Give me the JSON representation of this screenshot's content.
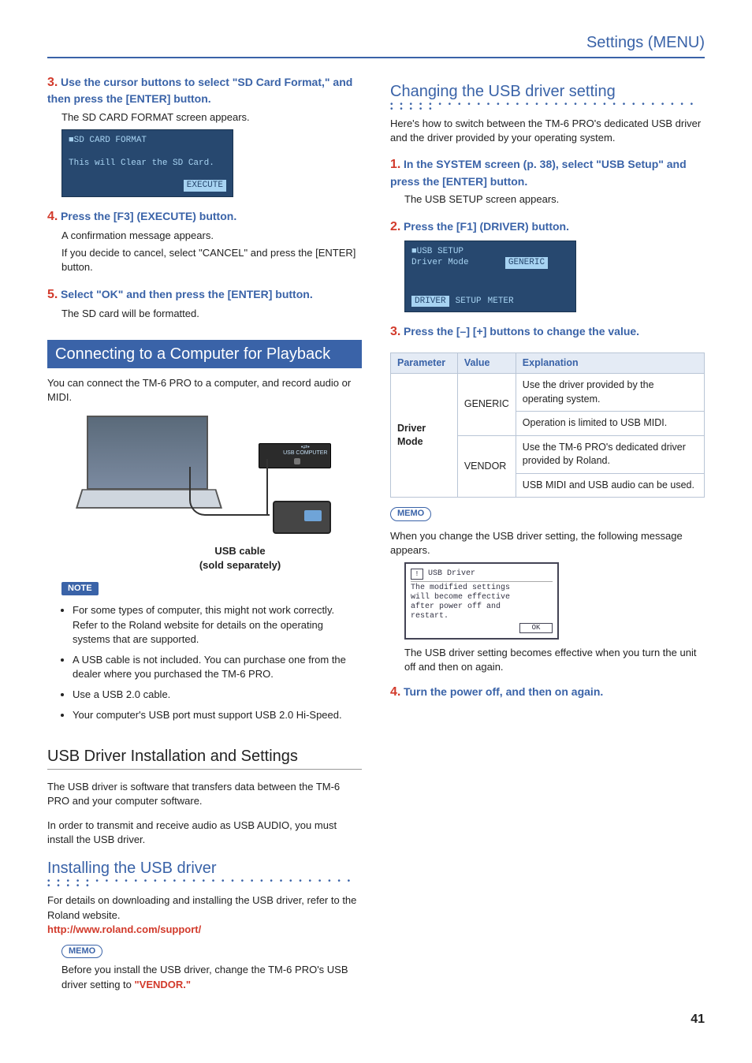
{
  "header": {
    "section": "Settings (MENU)"
  },
  "left": {
    "step3": {
      "num": "3.",
      "head": "Use the cursor buttons to select \"SD Card Format,\" and then press the [ENTER] button.",
      "body": "The SD CARD FORMAT screen appears.",
      "screen": {
        "title": "SD CARD FORMAT",
        "msg": "This will Clear the SD Card.",
        "btn": "EXECUTE"
      }
    },
    "step4": {
      "num": "4.",
      "head": "Press the [F3] (EXECUTE) button.",
      "body1": "A confirmation message appears.",
      "body2": "If you decide to cancel, select \"CANCEL\" and press the [ENTER] button."
    },
    "step5": {
      "num": "5.",
      "head": "Select \"OK\" and then press the [ENTER] button.",
      "body": "The SD card will be formatted."
    },
    "h_connect": "Connecting to a Computer for Playback",
    "connect_body": "You can connect the TM-6 PRO to a computer, and record audio or MIDI.",
    "diagram": {
      "usb_label_top": "USB COMPUTER",
      "caption1": "USB cable",
      "caption2": "(sold separately)"
    },
    "note_label": "NOTE",
    "notes": [
      "For some types of computer, this might not work correctly. Refer to the Roland website for details on the operating systems that are supported.",
      "A USB cable is not included. You can purchase one from the dealer where you purchased the TM-6 PRO.",
      "Use a USB 2.0 cable.",
      "Your computer's USB port must support USB 2.0 Hi-Speed."
    ],
    "h_usbdrv": "USB Driver Installation and Settings",
    "usbdrv_p1": "The USB driver is software that transfers data between the TM-6 PRO and your computer software.",
    "usbdrv_p2": "In order to transmit and receive audio as USB AUDIO, you must install the USB driver.",
    "h_install": "Installing the USB driver",
    "install_body": "For details on downloading and installing the USB driver, refer to the Roland website.",
    "install_link": "http://www.roland.com/support/",
    "memo_label": "MEMO",
    "install_memo": "Before you install the USB driver, change the TM-6 PRO's USB driver setting to ",
    "install_memo_vendor": "\"VENDOR.\""
  },
  "right": {
    "h_change": "Changing the USB driver setting",
    "change_body": "Here's how to switch between the TM-6 PRO's dedicated USB driver and the driver provided by your operating system.",
    "step1": {
      "num": "1.",
      "head": "In the SYSTEM screen (p. 38), select \"USB Setup\" and press the [ENTER] button.",
      "body": "The USB SETUP screen appears."
    },
    "step2": {
      "num": "2.",
      "head": "Press the [F1] (DRIVER) button.",
      "screen": {
        "title": "USB SETUP",
        "row_label": "Driver Mode",
        "row_val": "GENERIC",
        "btn1": "DRIVER",
        "btn2": "SETUP",
        "btn3": "METER"
      }
    },
    "step3": {
      "num": "3.",
      "head": "Press the [–] [+] buttons to change the value."
    },
    "table": {
      "cols": [
        "Parameter",
        "Value",
        "Explanation"
      ],
      "param": "Driver Mode",
      "rows": [
        {
          "value": "GENERIC",
          "exp1": "Use the driver provided by the operating system.",
          "exp2": "Operation is limited to USB MIDI."
        },
        {
          "value": "VENDOR",
          "exp1": "Use the TM-6 PRO's dedicated driver provided by Roland.",
          "exp2": "USB MIDI and USB audio can be used."
        }
      ]
    },
    "memo_label": "MEMO",
    "memo_p1": "When you change the USB driver setting, the following message appears.",
    "msgbox": {
      "title": "USB Driver",
      "body": "The modified settings\nwill become effective\nafter power off and\nrestart.",
      "ok": "OK"
    },
    "memo_p2": "The USB driver setting becomes effective when you turn the unit off and then on again.",
    "step4": {
      "num": "4.",
      "head": "Turn the power off, and then on again."
    }
  },
  "page": "41"
}
